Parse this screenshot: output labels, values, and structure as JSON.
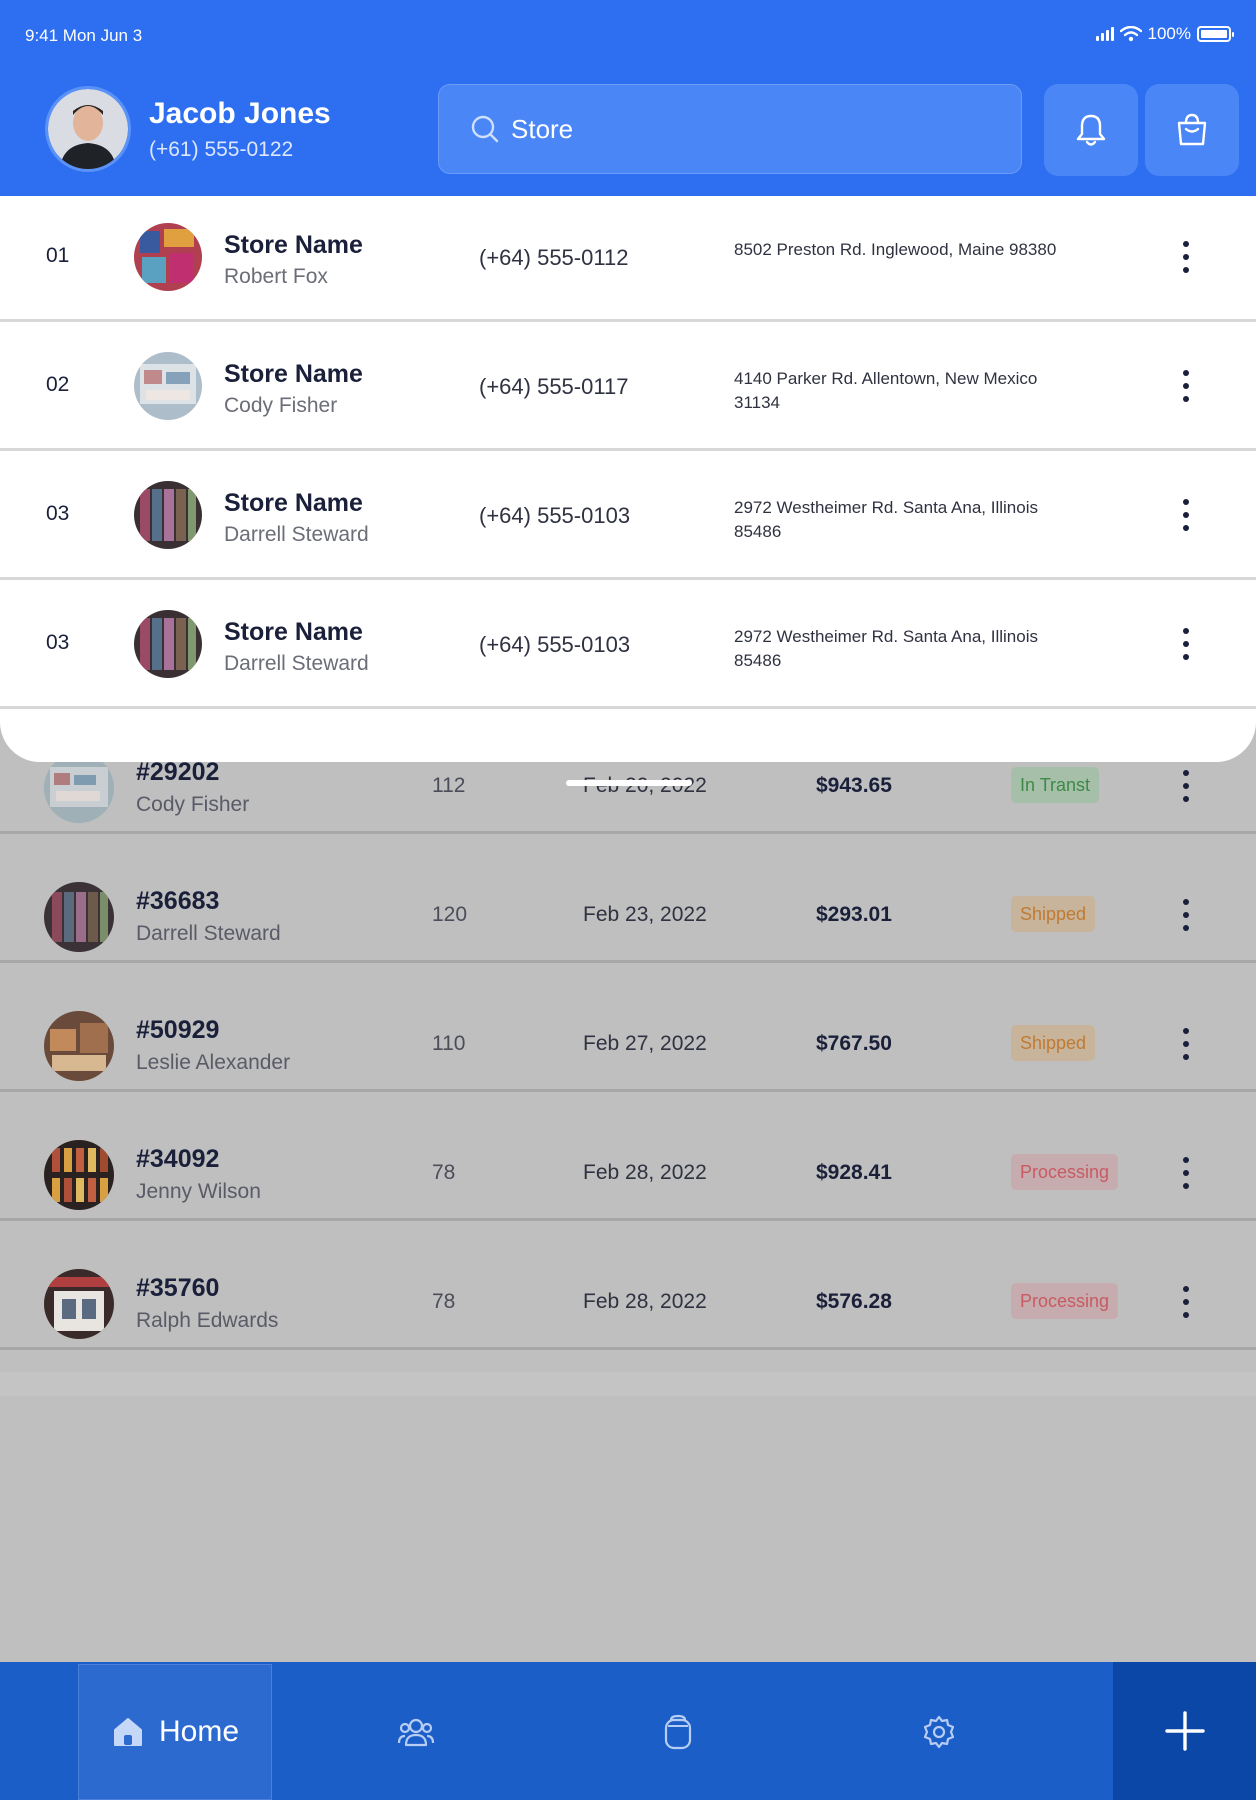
{
  "status_bar": {
    "time": "9:41  Mon Jun 3",
    "battery": "100%"
  },
  "header": {
    "user_name": "Jacob Jones",
    "user_phone": "(+61) 555-0122",
    "search": {
      "value": "",
      "placeholder": "Store"
    }
  },
  "stores": [
    {
      "num": "01",
      "name": "Store Name",
      "owner": "Robert Fox",
      "phone": "(+64) 555-0112",
      "address": "8502 Preston Rd. Inglewood, Maine 98380"
    },
    {
      "num": "02",
      "name": "Store Name",
      "owner": "Cody Fisher",
      "phone": "(+64) 555-0117",
      "address": "4140 Parker Rd. Allentown, New Mexico 31134"
    },
    {
      "num": "03",
      "name": "Store Name",
      "owner": "Darrell Steward",
      "phone": "(+64) 555-0103",
      "address": "2972 Westheimer Rd. Santa Ana, Illinois 85486"
    },
    {
      "num": "03",
      "name": "Store Name",
      "owner": "Darrell Steward",
      "phone": "(+64) 555-0103",
      "address": "2972 Westheimer Rd. Santa Ana, Illinois 85486"
    }
  ],
  "orders": [
    {
      "id": "#29202",
      "name": "Cody Fisher",
      "qty": "112",
      "date": "Feb 20, 2022",
      "price": "$943.65",
      "status": "In Transt"
    },
    {
      "id": "#36683",
      "name": "Darrell Steward",
      "qty": "120",
      "date": "Feb 23, 2022",
      "price": "$293.01",
      "status": "Shipped"
    },
    {
      "id": "#50929",
      "name": "Leslie Alexander",
      "qty": "110",
      "date": "Feb 27, 2022",
      "price": "$767.50",
      "status": "Shipped"
    },
    {
      "id": "#34092",
      "name": "Jenny Wilson",
      "qty": "78",
      "date": "Feb 28, 2022",
      "price": "$928.41",
      "status": "Processing"
    },
    {
      "id": "#35760",
      "name": "Ralph Edwards",
      "qty": "78",
      "date": "Feb 28, 2022",
      "price": "$576.28",
      "status": "Processing"
    }
  ],
  "bottom_nav": {
    "home_label": "Home"
  },
  "colors": {
    "brand_blue": "#2d6ff0",
    "nav_blue": "#1c5ec8",
    "add_button": "#0a47a6",
    "status_transit": "#3d8a48",
    "status_shipped": "#c07a32",
    "status_processing": "#c85a62"
  },
  "icons": {
    "header": [
      "search-icon",
      "bell-icon",
      "shopping-bag-icon"
    ],
    "rows": [
      "more-vertical-icon"
    ],
    "nav": [
      "home-icon",
      "users-icon",
      "cards-icon",
      "settings-icon",
      "plus-icon"
    ]
  }
}
